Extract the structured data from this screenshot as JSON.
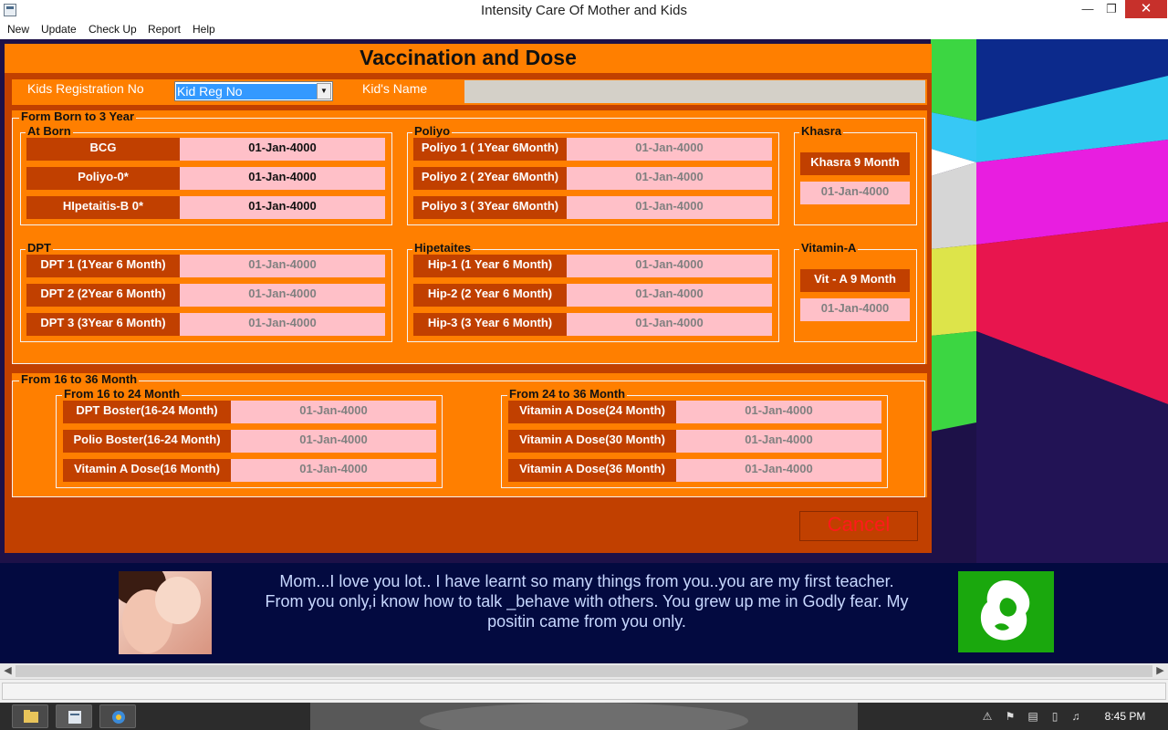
{
  "window": {
    "title": "Intensity Care Of Mother and Kids",
    "min": "—",
    "max": "❐",
    "close": "✕"
  },
  "menu": [
    "New",
    "Update",
    "Check Up",
    "Report",
    "Help"
  ],
  "form": {
    "title": "Vaccination and Dose",
    "reg_label": "Kids Registration No",
    "reg_value": "Kid Reg No",
    "name_label": "Kid's Name",
    "name_value": "",
    "section1_title": "Form Born to 3 Year",
    "groups": {
      "at_born": {
        "title": "At Born",
        "items": [
          {
            "label": "BCG",
            "date": "01-Jan-4000"
          },
          {
            "label": "Poliyo-0*",
            "date": "01-Jan-4000"
          },
          {
            "label": "HIpetaitis-B 0*",
            "date": "01-Jan-4000"
          }
        ]
      },
      "poliyo": {
        "title": "Poliyo",
        "items": [
          {
            "label": "Poliyo 1 ( 1Year 6Month)",
            "date": "01-Jan-4000"
          },
          {
            "label": "Poliyo 2 ( 2Year 6Month)",
            "date": "01-Jan-4000"
          },
          {
            "label": "Poliyo 3 ( 3Year 6Month)",
            "date": "01-Jan-4000"
          }
        ]
      },
      "khasra": {
        "title": "Khasra",
        "items": [
          {
            "label": "Khasra 9 Month",
            "date": "01-Jan-4000"
          }
        ]
      },
      "dpt": {
        "title": "DPT",
        "items": [
          {
            "label": "DPT 1 (1Year 6 Month)",
            "date": "01-Jan-4000"
          },
          {
            "label": "DPT 2 (2Year 6 Month)",
            "date": "01-Jan-4000"
          },
          {
            "label": "DPT 3 (3Year 6 Month)",
            "date": "01-Jan-4000"
          }
        ]
      },
      "hipetaites": {
        "title": "Hipetaites",
        "items": [
          {
            "label": "Hip-1 (1 Year 6 Month)",
            "date": "01-Jan-4000"
          },
          {
            "label": "Hip-2 (2 Year 6 Month)",
            "date": "01-Jan-4000"
          },
          {
            "label": "Hip-3 (3 Year 6 Month)",
            "date": "01-Jan-4000"
          }
        ]
      },
      "vitamin_a": {
        "title": "Vitamin-A",
        "items": [
          {
            "label": "Vit - A 9 Month",
            "date": "01-Jan-4000"
          }
        ]
      }
    },
    "section2_title": "From 16 to 36 Month",
    "groups2": {
      "m16_24": {
        "title": "From 16 to 24 Month",
        "items": [
          {
            "label": "DPT Boster(16-24 Month)",
            "date": "01-Jan-4000"
          },
          {
            "label": "Polio Boster(16-24 Month)",
            "date": "01-Jan-4000"
          },
          {
            "label": "Vitamin A Dose(16 Month)",
            "date": "01-Jan-4000"
          }
        ]
      },
      "m24_36": {
        "title": "From 24 to 36 Month",
        "items": [
          {
            "label": "Vitamin A Dose(24 Month)",
            "date": "01-Jan-4000"
          },
          {
            "label": "Vitamin A Dose(30 Month)",
            "date": "01-Jan-4000"
          },
          {
            "label": "Vitamin A Dose(36 Month)",
            "date": "01-Jan-4000"
          }
        ]
      }
    },
    "cancel_label": "Cancel"
  },
  "banner": {
    "line1": "Mom...I love you lot.. I have learnt so many things from you..you are my first teacher.",
    "line2": "From you only,i know how to talk _behave with others. You grew up me in Godly fear. My",
    "line3": "positin came from you only."
  },
  "scroll": {
    "left": "◀",
    "right": "▶"
  },
  "taskbar": {
    "clock": "8:45 PM"
  },
  "colors": {
    "form_dark": "#c14000",
    "form_orange": "#ff7f00",
    "date_pink": "#ffc0c8",
    "banner_navy": "#030a40",
    "cancel_red": "#ff1a1a"
  }
}
